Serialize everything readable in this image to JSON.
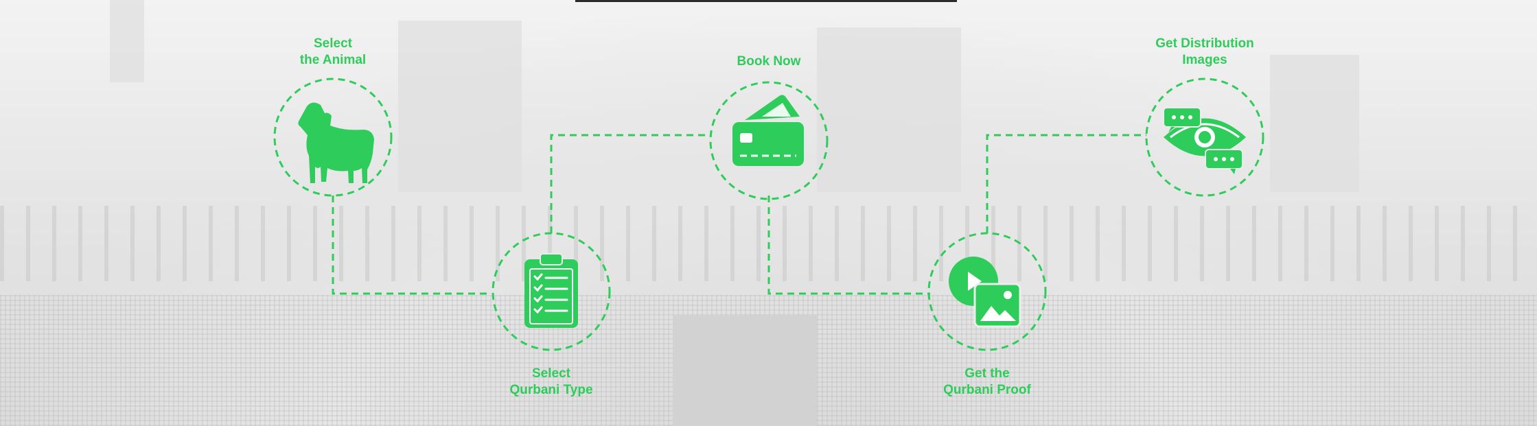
{
  "colors": {
    "accent": "#2ecc5a",
    "background": "#ececec"
  },
  "steps": [
    {
      "icon": "goat-icon",
      "line1": "Select",
      "line2": "the Animal"
    },
    {
      "icon": "clipboard-checklist-icon",
      "line1": "Select",
      "line2": "Qurbani Type"
    },
    {
      "icon": "credit-card-icon",
      "line1": "Book Now",
      "line2": ""
    },
    {
      "icon": "video-image-icon",
      "line1": "Get the",
      "line2": "Qurbani Proof"
    },
    {
      "icon": "eye-chat-icon",
      "line1": "Get Distribution",
      "line2": "Images"
    }
  ]
}
